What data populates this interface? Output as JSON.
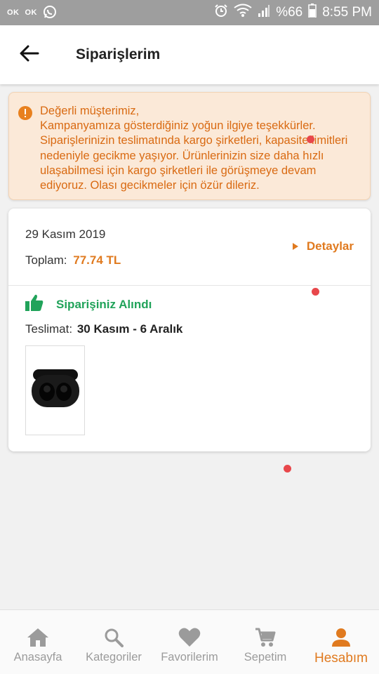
{
  "status_bar": {
    "ok_1": "OK",
    "ok_2": "OK",
    "battery": "%66",
    "time": "8:55 PM"
  },
  "header": {
    "title": "Siparişlerim"
  },
  "notice": {
    "text": "Değerli müşterimiz,\nKampanyamıza gösterdiğiniz yoğun ilgiye teşekkürler. Siparişlerinizin teslimatında kargo şirketleri, kapasite limitleri nedeniyle gecikme yaşıyor. Ürünlerinizin size daha hızlı ulaşabilmesi için kargo şirketleri ile görüşmeye devam ediyoruz. Olası gecikmeler için özür dileriz."
  },
  "order": {
    "date": "29 Kasım 2019",
    "total_label": "Toplam:",
    "total_value": "77.74 TL",
    "details_label": "Detaylar",
    "status": "Siparişiniz Alındı",
    "delivery_label": "Teslimat:",
    "delivery_dates": "30 Kasım - 6 Aralık"
  },
  "bottom_nav": {
    "items": [
      {
        "label": "Anasayfa",
        "icon": "home-icon"
      },
      {
        "label": "Kategoriler",
        "icon": "search-icon"
      },
      {
        "label": "Favorilerim",
        "icon": "heart-icon"
      },
      {
        "label": "Sepetim",
        "icon": "cart-icon"
      },
      {
        "label": "Hesabım",
        "icon": "person-icon"
      }
    ],
    "active_index": 4
  },
  "colors": {
    "accent": "#e07a1f",
    "success": "#21a35a",
    "notice_bg": "#fbe9d8",
    "status_bar": "#9e9e9e"
  }
}
